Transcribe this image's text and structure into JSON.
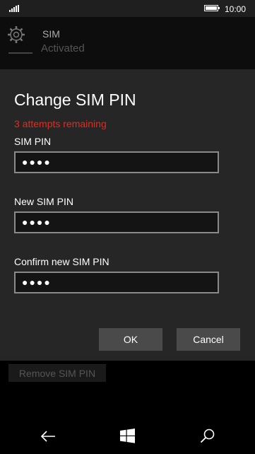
{
  "status_bar": {
    "time": "10:00"
  },
  "app_bar": {
    "title": "SIM",
    "status_text": "Activated"
  },
  "background": {
    "remove_pin_button": "Remove SIM PIN"
  },
  "dialog": {
    "title": "Change SIM PIN",
    "attempts_text": "3 attempts remaining",
    "fields": [
      {
        "label": "SIM PIN",
        "value": "●●●●"
      },
      {
        "label": "New SIM PIN",
        "value": "●●●●"
      },
      {
        "label": "Confirm new SIM PIN",
        "value": "●●●●"
      }
    ],
    "ok_label": "OK",
    "cancel_label": "Cancel"
  },
  "colors": {
    "warning": "#e8291c",
    "dialog_bg": "#262626",
    "button_bg": "#4a4a4a"
  },
  "icons": [
    "signal-icon",
    "battery-icon",
    "settings-gear-icon",
    "back-icon",
    "windows-start-icon",
    "search-icon"
  ]
}
